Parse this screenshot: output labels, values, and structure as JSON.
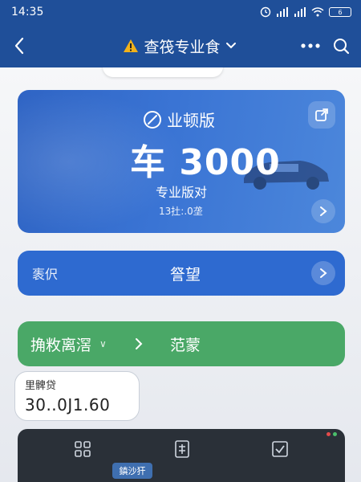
{
  "status_bar": {
    "time": "14:35",
    "battery": "6"
  },
  "nav": {
    "title": "查筏专业食",
    "back_icon": "chevron-left-icon",
    "warning_icon": "warning-icon",
    "dropdown_icon": "chevron-down-icon",
    "more_icon": "more-icon",
    "search_icon": "search-icon"
  },
  "hero": {
    "badge": "业顿版",
    "value": "车 3000",
    "subtitle": "专业版对",
    "meta": "13扗:.0垄"
  },
  "row_blue": {
    "left": "袠伬",
    "center": "詧望"
  },
  "row_green": {
    "left": "捔敉离滘",
    "small": "∨",
    "center": "范蒙"
  },
  "pill": {
    "label": "里髀贷",
    "value": "30..0J1.60"
  },
  "bottom": {
    "tag": "鎮沙犴"
  },
  "colors": {
    "nav_bg": "#1f4f99",
    "hero_blue": "#3a74d4",
    "row_blue": "#2e6ad0",
    "row_green": "#4aa867",
    "dark_bar": "#2a3038"
  }
}
